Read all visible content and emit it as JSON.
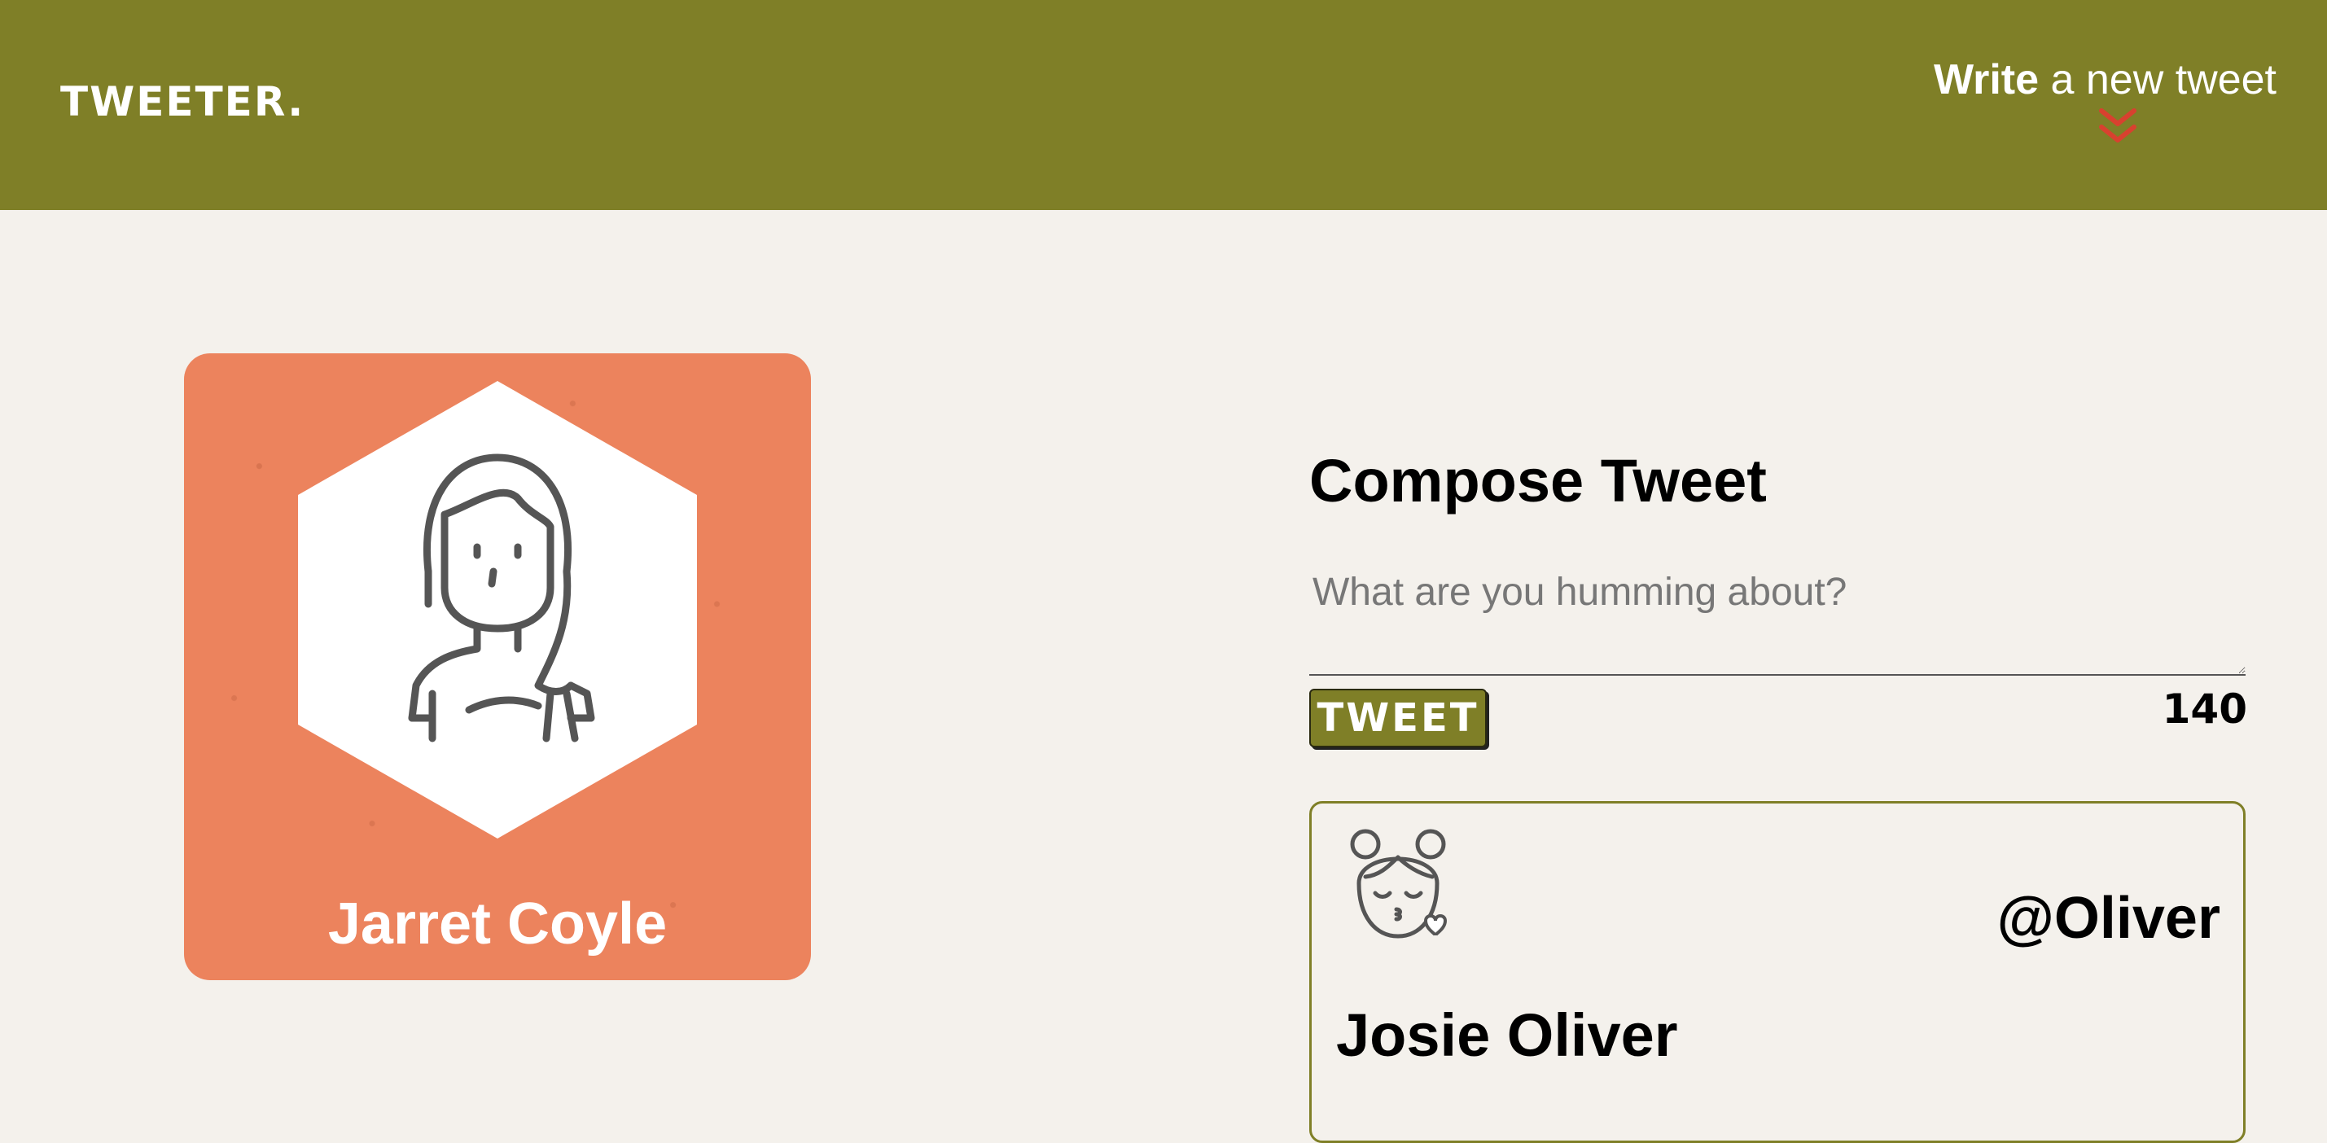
{
  "header": {
    "brand": "TWEETER.",
    "write_strong": "Write",
    "write_rest": " a new tweet",
    "arrow_icon": "double-chevron-down-icon",
    "arrow_color": "#d8412f",
    "background_color": "#7f7f27"
  },
  "profile": {
    "name": "Jarret Coyle",
    "card_color": "#ec835d",
    "avatar_icon": "girl-avatar-icon"
  },
  "compose": {
    "title": "Compose Tweet",
    "placeholder": "What are you humming about?",
    "button_label": "TWEET",
    "counter": "140"
  },
  "tweets": [
    {
      "avatar_icon": "kissing-girl-avatar-icon",
      "handle": "@Oliver",
      "author": "Josie Oliver"
    }
  ]
}
